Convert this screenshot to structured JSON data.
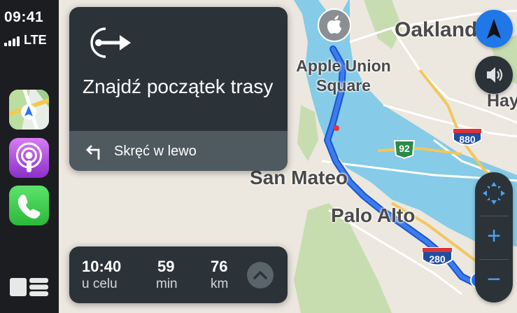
{
  "status": {
    "time": "09:41",
    "network": "LTE",
    "signal_bars": 4
  },
  "dock": {
    "apps": [
      {
        "name": "Mapy",
        "icon": "maps-icon"
      },
      {
        "name": "Podcasty",
        "icon": "podcasts-icon"
      },
      {
        "name": "Telefon",
        "icon": "phone-icon"
      }
    ],
    "dashboard_icon": "dashboard-icon"
  },
  "navigation": {
    "maneuver_icon": "route-start-icon",
    "title": "Znajdź początek trasy",
    "next_icon": "turn-left-icon",
    "next_instruction": "Skręć w lewo"
  },
  "trip": {
    "arrival_time": "10:40",
    "arrival_label": "u celu",
    "duration": "59",
    "duration_unit": "min",
    "distance": "76",
    "distance_unit": "km"
  },
  "map": {
    "labels": {
      "oakland": "Oakland",
      "apple_union_square": "Apple Union Square",
      "hayward": "Hayw",
      "san_mateo": "San Mateo",
      "palo_alto": "Palo Alto"
    },
    "shields": {
      "i880": "880",
      "r92": "92",
      "i280": "280"
    },
    "route_color": "#3d7cf0"
  },
  "controls": {
    "compass_icon": "compass-icon",
    "audio_icon": "speaker-icon",
    "pan_icon": "pan-arrows-icon",
    "zoom_in": "+",
    "zoom_out": "−"
  },
  "colors": {
    "water": "#86cbe7",
    "land": "#ece7df",
    "green": "#c7ddb0",
    "panel": "#2b3339"
  }
}
